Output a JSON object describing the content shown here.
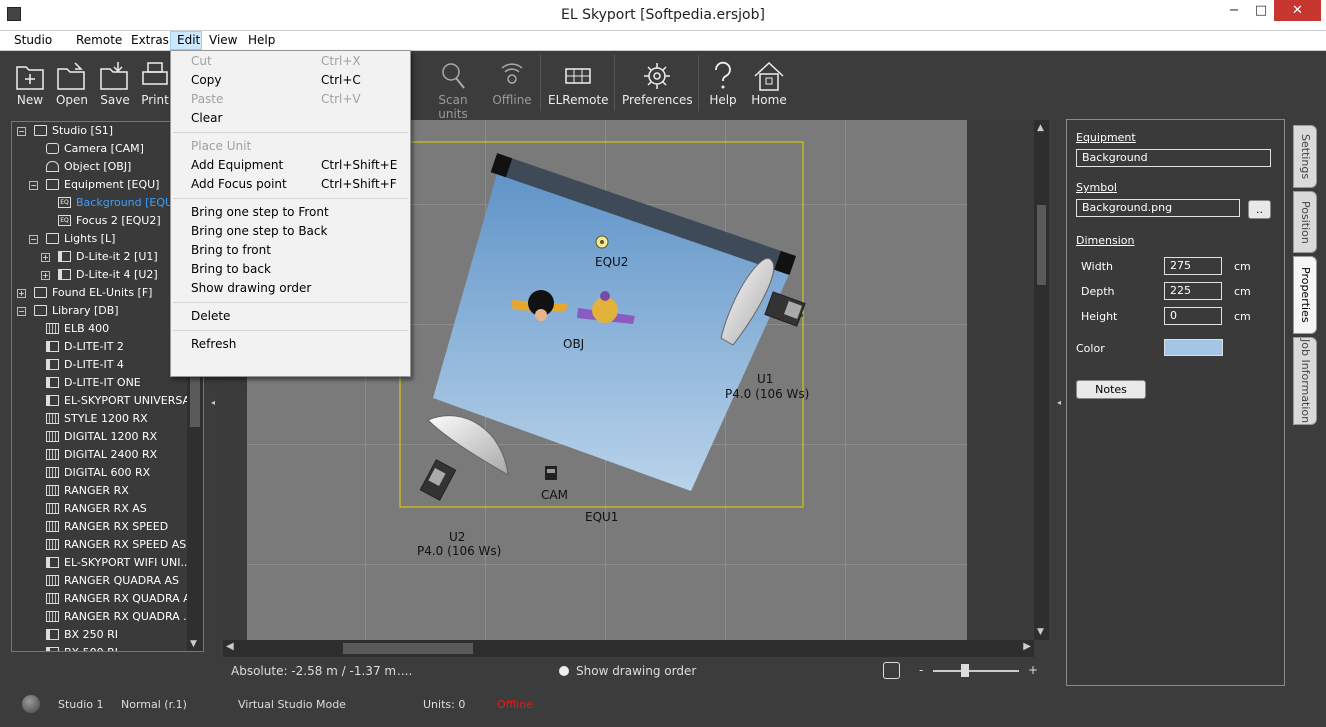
{
  "window": {
    "title": "EL Skyport [Softpedia.ersjob]",
    "btn_min": "−",
    "btn_max": "□",
    "btn_close": "✕"
  },
  "menu": {
    "items": [
      "Studio",
      "Remote",
      "Extras",
      "Edit",
      "View",
      "Help"
    ]
  },
  "toolbar": {
    "new": "New",
    "open": "Open",
    "save": "Save",
    "print": "Print",
    "scan": "Scan units",
    "offline": "Offline",
    "elremote": "ELRemote",
    "prefs": "Preferences",
    "help": "Help",
    "home": "Home"
  },
  "edit_menu": {
    "cut": "Cut",
    "cut_sc": "Ctrl+X",
    "copy": "Copy",
    "copy_sc": "Ctrl+C",
    "paste": "Paste",
    "paste_sc": "Ctrl+V",
    "clear": "Clear",
    "place": "Place Unit",
    "add_eq": "Add Equipment",
    "add_eq_sc": "Ctrl+Shift+E",
    "add_focus": "Add Focus point",
    "add_focus_sc": "Ctrl+Shift+F",
    "front1": "Bring one step to Front",
    "back1": "Bring one step to Back",
    "front": "Bring to front",
    "back": "Bring to back",
    "order": "Show drawing order",
    "delete": "Delete",
    "refresh": "Refresh"
  },
  "tree": {
    "items": [
      "Studio [S1]",
      "Camera [CAM]",
      "Object [OBJ]",
      "Equipment [EQU]",
      "Background [EQU",
      "Focus 2 [EQU2]",
      "Lights  [L]",
      "D-Lite-it 2 [U1]",
      "D-Lite-it 4 [U2]",
      "Found EL-Units [F]",
      "Library [DB]",
      "ELB 400",
      "D-LITE-IT 2",
      "D-LITE-IT 4",
      "D-LITE-IT ONE",
      "EL-SKYPORT UNIVERSAL",
      "STYLE 1200 RX",
      "DIGITAL 1200 RX",
      "DIGITAL 2400 RX",
      "DIGITAL 600 RX",
      "RANGER RX",
      "RANGER RX AS",
      "RANGER RX SPEED",
      "RANGER RX SPEED AS",
      "EL-SKYPORT WIFI UNI...",
      "RANGER QUADRA AS",
      "RANGER RX QUADRA AS",
      "RANGER RX QUADRA ...",
      "BX 250 RI",
      "BX 500 RI"
    ]
  },
  "canvas": {
    "equ2": "EQU2",
    "obj": "OBJ",
    "u1": "U1",
    "u1_power": "P4.0 (106 Ws)",
    "u2": "U2",
    "u2_power": "P4.0 (106 Ws)",
    "cam": "CAM",
    "equ1": "EQU1"
  },
  "status": {
    "absolute": "Absolute: -2.58 m / -1.37 m",
    "dots": "....",
    "show_order": "Show drawing order",
    "zoom_minus": "-",
    "zoom_plus": "+",
    "studio": "Studio 1",
    "normal": "Normal (r.1)",
    "mode": "Virtual Studio Mode",
    "units": "Units: 0",
    "offline": "Offline"
  },
  "properties": {
    "equipment_label": "Equipment",
    "equipment_value": "Background",
    "symbol_label": "Symbol",
    "symbol_value": "Background.png",
    "browse": "..",
    "dimension_label": "Dimension",
    "width_label": "Width",
    "width_value": "275",
    "width_unit": "cm",
    "depth_label": "Depth",
    "depth_value": "225",
    "depth_unit": "cm",
    "height_label": "Height",
    "height_value": "0",
    "height_unit": "cm",
    "color_label": "Color",
    "color_value": "#a4c6e6",
    "notes": "Notes"
  },
  "tabs": [
    "Settings",
    "Position",
    "Properties",
    "Job Information"
  ],
  "colors": {
    "offline": "#d42020",
    "selection": "#3aa0ff",
    "frame": "#e6d200"
  }
}
